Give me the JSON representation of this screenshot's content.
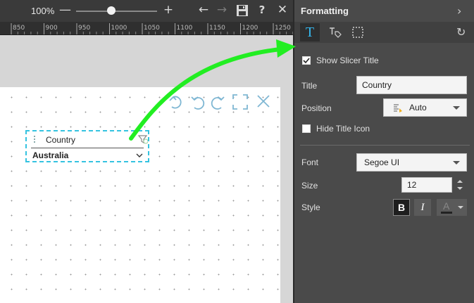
{
  "toolbar": {
    "zoom": "100%",
    "zoom_minus": "—",
    "zoom_plus": "+",
    "back": "←",
    "forward": "→",
    "help": "?",
    "close": "✕"
  },
  "ruler": {
    "ticks": [
      "850",
      "900",
      "950",
      "1000",
      "1050",
      "1100",
      "1150",
      "1200",
      "1250"
    ]
  },
  "slicer": {
    "title": "Country",
    "value": "Australia"
  },
  "panel": {
    "title": "Formatting",
    "show_title_label": "Show Slicer Title",
    "show_title_checked": true,
    "title_label": "Title",
    "title_value": "Country",
    "position_label": "Position",
    "position_value": "Auto",
    "hide_title_icon_label": "Hide Title Icon",
    "hide_title_icon_checked": false,
    "font_label": "Font",
    "font_value": "Segoe UI",
    "size_label": "Size",
    "size_value": "12",
    "style_label": "Style",
    "bold": "B",
    "italic": "I",
    "font_color_glyph": "A"
  },
  "colors": {
    "accent": "#35b8f0",
    "selection_border": "#35c3e0",
    "arrow": "#22ee22",
    "panel_bg": "#4a4a4a"
  }
}
